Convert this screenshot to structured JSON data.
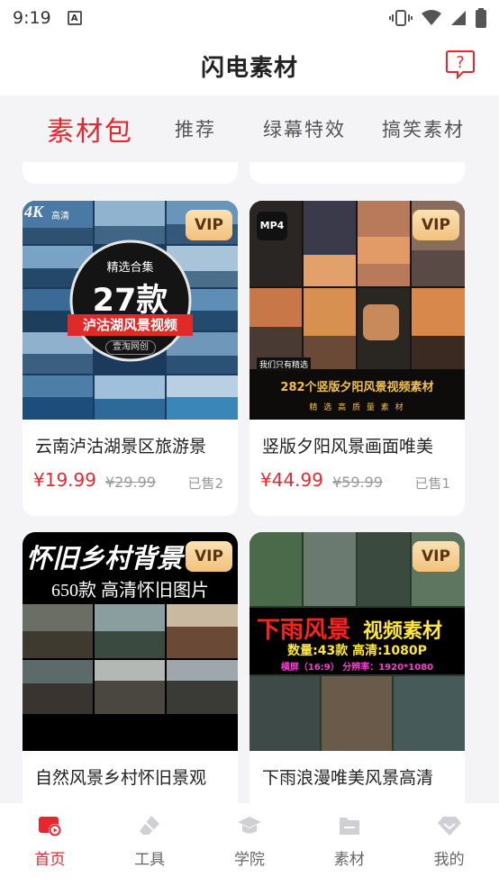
{
  "status_bar": {
    "time": "9:19"
  },
  "header": {
    "title": "闪电素材"
  },
  "tabs": [
    {
      "label": "素材包",
      "active": true
    },
    {
      "label": "推荐",
      "active": false
    },
    {
      "label": "绿幕特效",
      "active": false
    },
    {
      "label": "搞笑素材",
      "active": false
    }
  ],
  "products": [
    {
      "title": "云南泸沽湖景区旅游景",
      "price": "¥19.99",
      "original_price": "¥29.99",
      "sold": "已售2",
      "badge": "VIP",
      "thumb": {
        "corner": "4K",
        "corner_sub": "高清",
        "top_label": "精选合集",
        "big": "27款",
        "ribbon": "泸沽湖风景视频",
        "small": "壹淘网创"
      }
    },
    {
      "title": "竖版夕阳风景画面唯美",
      "price": "¥44.99",
      "original_price": "¥59.99",
      "sold": "已售1",
      "badge": "VIP",
      "thumb": {
        "corner": "MP4",
        "tag": "我们只有精选",
        "line1": "282个竖版夕阳风景视频素材",
        "line2": "精 选 高 质 量 素 材"
      }
    },
    {
      "title": "自然风景乡村怀旧景观",
      "badge": "VIP",
      "thumb": {
        "headline": "怀旧乡村背景",
        "sub": "650款  高清怀旧图片"
      }
    },
    {
      "title": "下雨浪漫唯美风景高清",
      "badge": "VIP",
      "thumb": {
        "headline_red": "下雨风景",
        "headline_yellow": "视频素材",
        "line1": "数量:43款  高清:1080P",
        "line2": "横屏（16:9） 分辨率：1920*1080"
      }
    }
  ],
  "bottom_nav": [
    {
      "label": "首页",
      "icon": "home-play-icon",
      "active": true
    },
    {
      "label": "工具",
      "icon": "eraser-icon",
      "active": false
    },
    {
      "label": "学院",
      "icon": "graduation-cap-icon",
      "active": false
    },
    {
      "label": "素材",
      "icon": "folder-icon",
      "active": false
    },
    {
      "label": "我的",
      "icon": "diamond-icon",
      "active": false
    }
  ],
  "colors": {
    "accent": "#e8262e",
    "vip_gold": "#f0c27d",
    "background": "#f4f4f6"
  }
}
